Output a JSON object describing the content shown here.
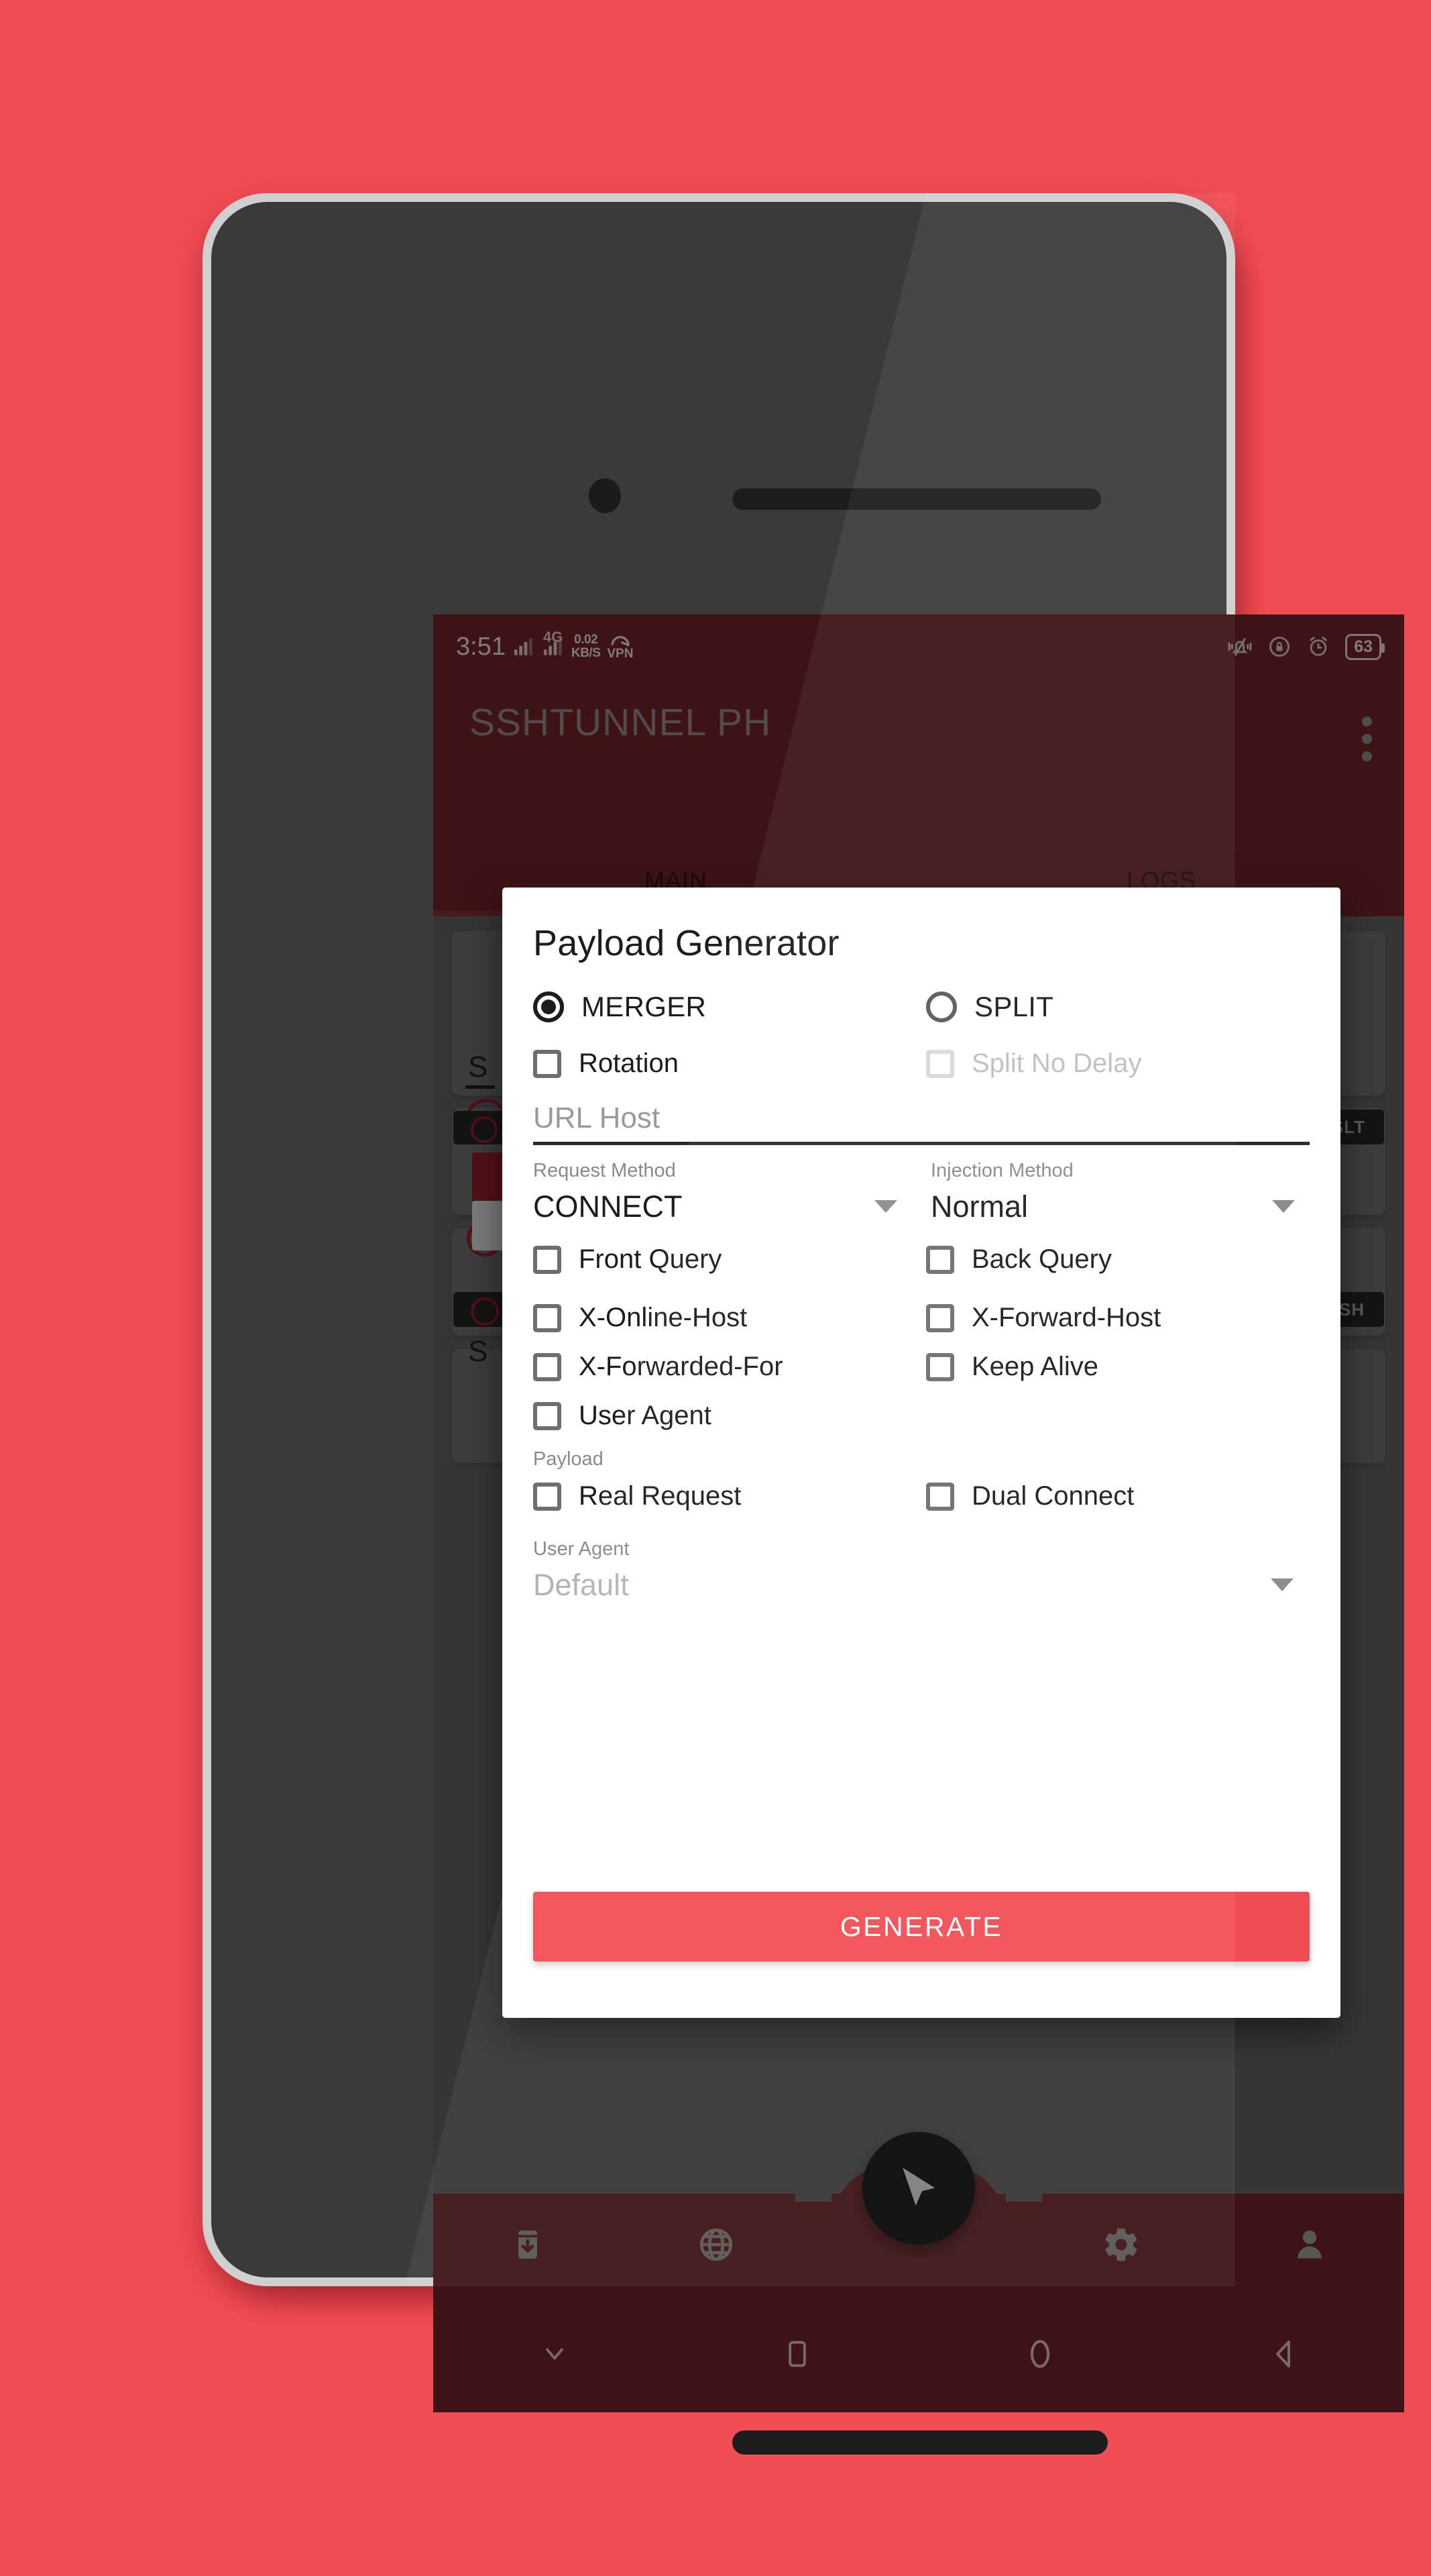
{
  "status_bar": {
    "clock": "3:51",
    "network_type": "4G",
    "net_speed_value": "0.02",
    "net_speed_unit": "KB/S",
    "vpn_label": "VPN",
    "battery_percent": "63",
    "icons": [
      "signal-icon",
      "signal-icon",
      "net-speed-icon",
      "vpn-icon",
      "vibrate-off-icon",
      "rotation-lock-icon",
      "alarm-icon",
      "battery-icon"
    ]
  },
  "app_bar": {
    "title": "SSHTUNNEL PH",
    "overflow_label": "More options"
  },
  "tabs": [
    {
      "label": "MAIN",
      "active": true
    },
    {
      "label": "LOGS",
      "active": false
    }
  ],
  "background": {
    "chips": [
      "SLT",
      "SH"
    ],
    "partial_texts": [
      "S",
      "S"
    ]
  },
  "dialog": {
    "title": "Payload Generator",
    "modes": [
      {
        "label": "MERGER",
        "selected": true
      },
      {
        "label": "SPLIT",
        "selected": false
      }
    ],
    "mode_options": [
      {
        "label": "Rotation",
        "checked": false,
        "disabled": false
      },
      {
        "label": "Split No Delay",
        "checked": false,
        "disabled": true
      }
    ],
    "url_host": {
      "placeholder": "URL Host",
      "value": ""
    },
    "request_method": {
      "caption": "Request Method",
      "value": "CONNECT"
    },
    "injection_method": {
      "caption": "Injection Method",
      "value": "Normal"
    },
    "header_options": [
      {
        "label": "Front Query",
        "checked": false
      },
      {
        "label": "Back Query",
        "checked": false
      },
      {
        "label": "X-Online-Host",
        "checked": false
      },
      {
        "label": "X-Forward-Host",
        "checked": false
      },
      {
        "label": "X-Forwarded-For",
        "checked": false
      },
      {
        "label": "Keep Alive",
        "checked": false
      },
      {
        "label": "User Agent",
        "checked": false
      }
    ],
    "payload_section": {
      "caption": "Payload",
      "options": [
        {
          "label": "Real Request",
          "checked": false
        },
        {
          "label": "Dual Connect",
          "checked": false
        }
      ]
    },
    "user_agent": {
      "caption": "User Agent",
      "value": "Default"
    },
    "generate_label": "GENERATE"
  },
  "bottom_nav": [
    {
      "name": "download-icon"
    },
    {
      "name": "globe-icon"
    },
    {
      "name": "send-fab-icon"
    },
    {
      "name": "gear-icon"
    },
    {
      "name": "person-icon"
    }
  ],
  "android_nav": [
    {
      "name": "hide-keyboard-icon"
    },
    {
      "name": "recents-icon"
    },
    {
      "name": "home-icon"
    },
    {
      "name": "back-icon"
    }
  ],
  "colors": {
    "accent": "#F04D54",
    "app_bar": "#6b2225",
    "dialog_bg": "#ffffff",
    "text_primary": "#1c1c1c",
    "text_muted": "#8a8a8a"
  }
}
